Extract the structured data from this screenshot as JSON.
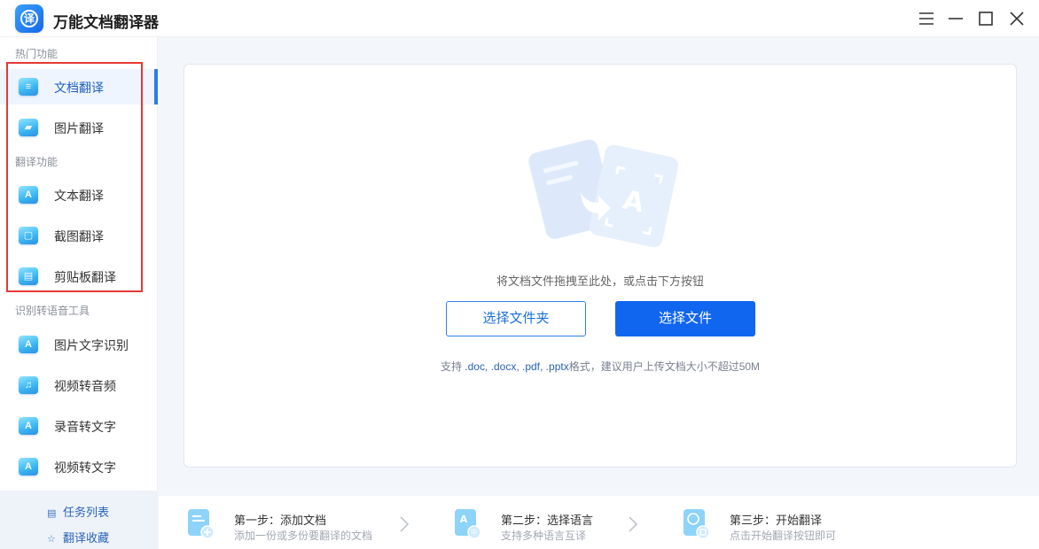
{
  "app": {
    "title": "万能文档翻译器",
    "logo_glyph": "译"
  },
  "window_controls": {
    "menu_icon": "hamburger-menu-icon",
    "minimize_icon": "minimize-icon",
    "maximize_icon": "maximize-icon",
    "close_icon": "close-icon"
  },
  "sidebar": {
    "sections": [
      {
        "title": "热门功能"
      },
      {
        "title": "翻译功能"
      },
      {
        "title": "识别转语音工具"
      }
    ],
    "items": [
      {
        "label": "文档翻译",
        "icon": "document-icon",
        "mark": "≡",
        "active": true
      },
      {
        "label": "图片翻译",
        "icon": "image-icon",
        "mark": "▰",
        "active": false
      },
      {
        "label": "文本翻译",
        "icon": "text-a-icon",
        "mark": "A",
        "active": false
      },
      {
        "label": "截图翻译",
        "icon": "screenshot-icon",
        "mark": "▢",
        "active": false
      },
      {
        "label": "剪贴板翻译",
        "icon": "clipboard-icon",
        "mark": "▤",
        "active": false
      },
      {
        "label": "图片文字识别",
        "icon": "ocr-icon",
        "mark": "A",
        "active": false
      },
      {
        "label": "视频转音频",
        "icon": "video-audio-icon",
        "mark": "♫",
        "active": false
      },
      {
        "label": "录音转文字",
        "icon": "recording-text-icon",
        "mark": "A",
        "active": false
      },
      {
        "label": "视频转文字",
        "icon": "video-text-icon",
        "mark": "A",
        "active": false
      }
    ],
    "bottom_links": [
      {
        "label": "任务列表",
        "icon": "task-list-icon",
        "glyph": "▤"
      },
      {
        "label": "翻译收藏",
        "icon": "star-icon",
        "glyph": "☆"
      }
    ]
  },
  "main": {
    "drop_hint": "将文档文件拖拽至此处，或点击下方按钮",
    "select_folder_label": "选择文件夹",
    "select_file_label": "选择文件",
    "support_prefix": "支持",
    "support_formats": ".doc, .docx, .pdf, .pptx",
    "support_suffix": "格式，建议用户上传文档大小不超过50M",
    "illustration_icon": "document-translate-illustration"
  },
  "steps": [
    {
      "title": "第一步：添加文档",
      "subtitle": "添加一份或多份要翻译的文档",
      "icon": "add-document-icon"
    },
    {
      "title": "第二步：选择语言",
      "subtitle": "支持多种语言互译",
      "icon": "language-icon"
    },
    {
      "title": "第三步：开始翻译",
      "subtitle": "点击开始翻译按钮即可",
      "icon": "start-translate-icon"
    }
  ],
  "colors": {
    "accent": "#1166f0",
    "highlight_box": "#e53935",
    "active_bar": "#2a7de1"
  }
}
